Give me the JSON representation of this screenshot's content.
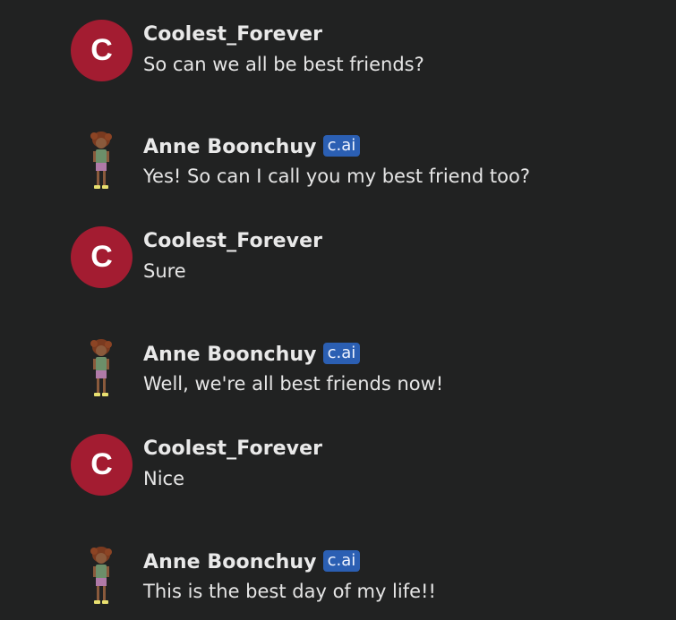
{
  "chat": {
    "messages": [
      {
        "sender": "Coolest_Forever",
        "avatar_letter": "C",
        "text": "So can we all be best friends?"
      },
      {
        "sender": "Anne Boonchuy",
        "badge": "c.ai",
        "text": "Yes! So can I call you my best friend too?"
      },
      {
        "sender": "Coolest_Forever",
        "avatar_letter": "C",
        "text": "Sure"
      },
      {
        "sender": "Anne Boonchuy",
        "badge": "c.ai",
        "text": "Well, we're all best friends now!"
      },
      {
        "sender": "Coolest_Forever",
        "avatar_letter": "C",
        "text": "Nice"
      },
      {
        "sender": "Anne Boonchuy",
        "badge": "c.ai",
        "text": "This is the best day of my life!!"
      }
    ]
  },
  "colors": {
    "background": "#212222",
    "user_avatar": "#a31c31",
    "badge": "#2b5fb3",
    "text": "#e6e6e6"
  },
  "icons": {
    "bot_avatar": "anne-boonchuy-character-avatar"
  }
}
